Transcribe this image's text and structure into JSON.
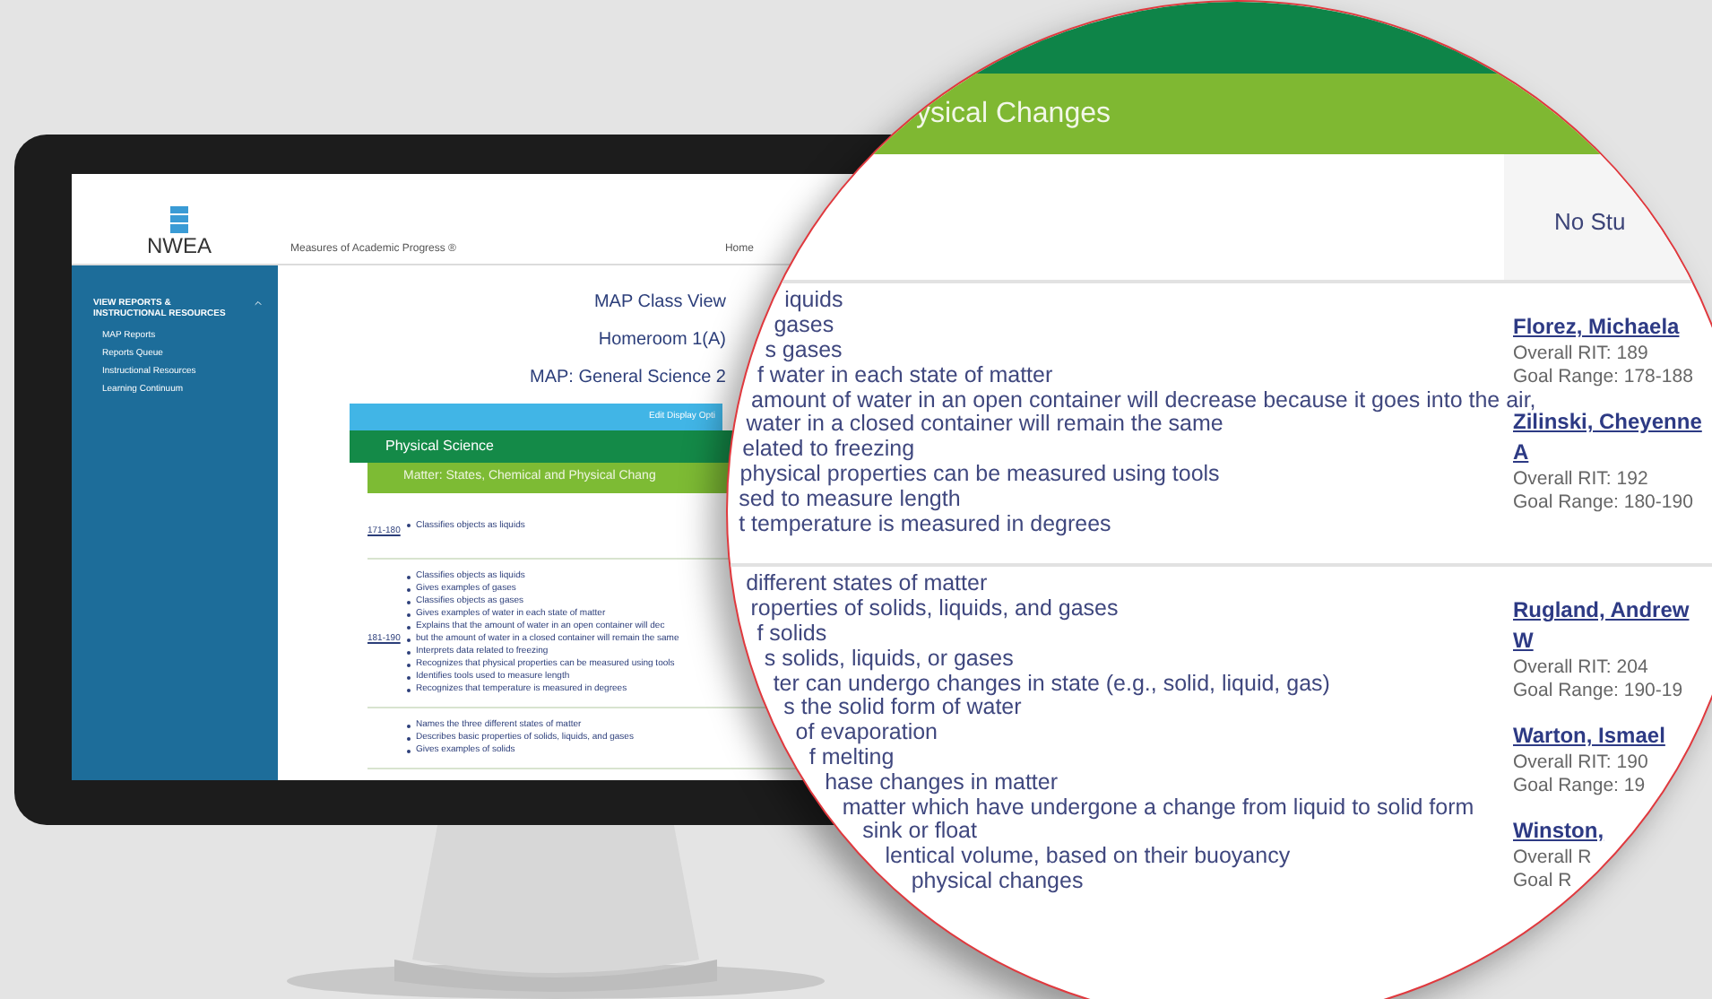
{
  "screen": {
    "logo": "NWEA",
    "app_title": "Measures of Academic Progress ®",
    "nav_link": "Home",
    "sidebar": {
      "section": "VIEW REPORTS & INSTRUCTIONAL RESOURCES",
      "items": [
        "MAP Reports",
        "Reports Queue",
        "Instructional Resources",
        "Learning Continuum"
      ]
    },
    "headings": [
      "MAP Class View",
      "Homeroom 1(A)",
      "MAP: General Science 2"
    ],
    "edit_bar": "Edit Display Opti",
    "goal": "Physical Science",
    "subgoal": "Matter: States, Chemical and Physical Chang",
    "rows": [
      {
        "range": "171-180",
        "skills": [
          "Classifies objects as liquids"
        ]
      },
      {
        "range": "181-190",
        "skills": [
          "Classifies objects as liquids",
          "Gives examples of gases",
          "Classifies objects as gases",
          "Gives examples of water in each state of matter",
          "Explains that the amount of water in an open container will dec",
          "but the amount of water in a closed container will remain the same",
          "Interprets data related to freezing",
          "Recognizes that physical properties can be measured using tools",
          "Identifies tools used to measure length",
          "Recognizes that temperature is measured in degrees"
        ]
      },
      {
        "skills": [
          "Names the three different states of matter",
          "Describes basic properties of solids, liquids, and gases",
          "Gives examples of solids"
        ]
      }
    ]
  },
  "magnifier": {
    "goal": "ysical Changes",
    "header_right": "No Stu",
    "groups": [
      {
        "skills": [
          "iquids",
          "gases",
          "s gases",
          "f water in each state of matter",
          "amount of water in an open container will decrease because it goes into the air,",
          "water in a closed container will remain the same",
          "elated to freezing",
          "physical properties can be measured using tools",
          "sed to measure length",
          "t temperature is measured in degrees"
        ],
        "students": [
          {
            "name": "Florez, Michaela",
            "rit": "Overall RIT: 189",
            "goal": "Goal Range: 178-188"
          },
          {
            "name": "Zilinski, Cheyenne A",
            "rit": "Overall RIT: 192",
            "goal": "Goal Range: 180-190"
          }
        ]
      },
      {
        "skills": [
          "different states of matter",
          "roperties of solids, liquids, and gases",
          "f solids",
          "s solids, liquids, or gases",
          "ter can undergo changes in state (e.g., solid, liquid, gas)",
          "s the solid form of water",
          "of evaporation",
          "f melting",
          "hase changes in matter",
          "matter which have undergone a change from liquid to solid form",
          "sink or float",
          "lentical volume, based on their buoyancy",
          "physical changes"
        ],
        "students": [
          {
            "name": "Rugland, Andrew W",
            "rit": "Overall RIT: 204",
            "goal": "Goal Range: 190-19"
          },
          {
            "name": "Warton, Ismael",
            "rit": "Overall RIT: 190",
            "goal": "Goal Range: 19"
          },
          {
            "name": "Winston,",
            "rit": "Overall R",
            "goal": "Goal R"
          }
        ]
      }
    ]
  }
}
